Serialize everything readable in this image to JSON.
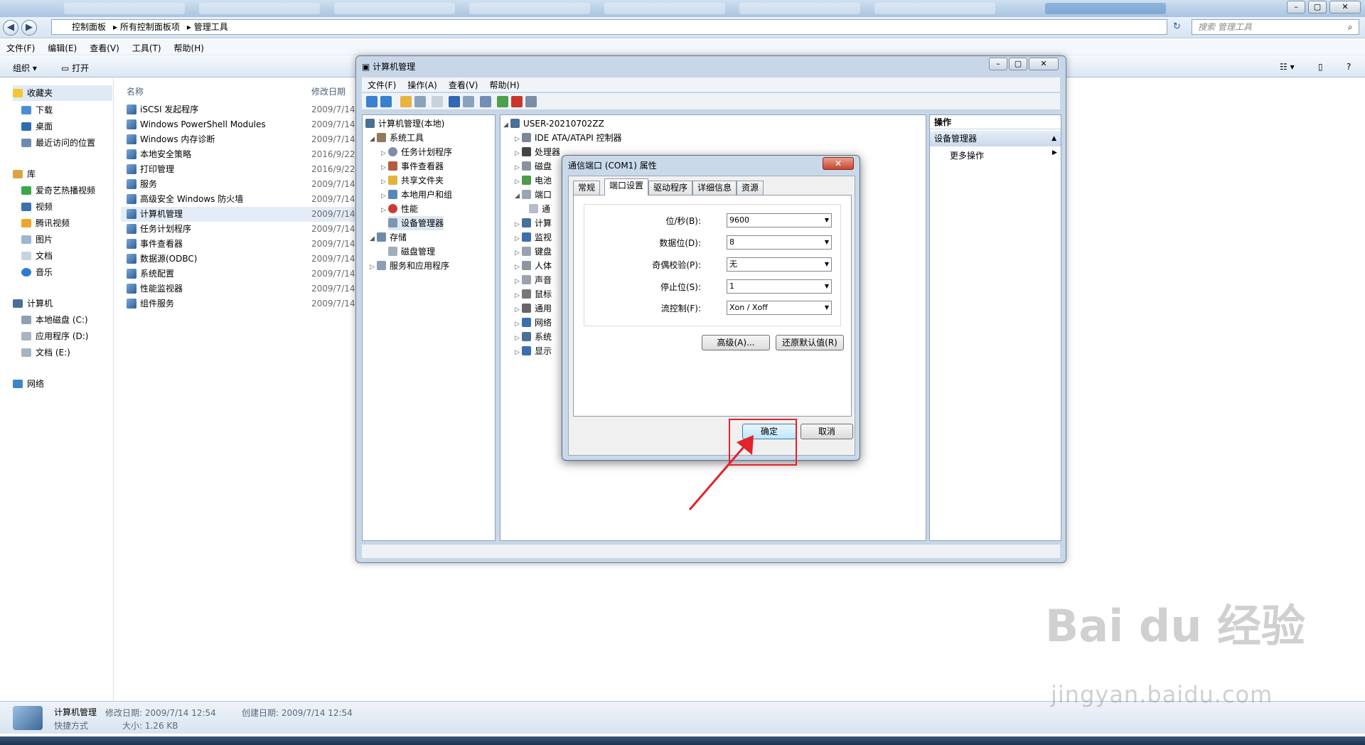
{
  "explorer": {
    "address": [
      "控制面板",
      "所有控制面板项",
      "管理工具"
    ],
    "search_placeholder": "搜索 管理工具",
    "menu": [
      "文件(F)",
      "编辑(E)",
      "查看(V)",
      "工具(T)",
      "帮助(H)"
    ],
    "toolbar": {
      "organize": "组织",
      "open": "打开"
    },
    "nav": {
      "favorites": "收藏夹",
      "fav_items": [
        "下载",
        "桌面",
        "最近访问的位置"
      ],
      "library": "库",
      "lib_items": [
        "爱奇艺热播视频",
        "视频",
        "腾讯视频",
        "图片",
        "文档",
        "音乐"
      ],
      "computer": "计算机",
      "drives": [
        "本地磁盘 (C:)",
        "应用程序 (D:)",
        "文档 (E:)"
      ],
      "network": "网络"
    },
    "columns": {
      "name": "名称",
      "date": "修改日期"
    },
    "files": [
      {
        "name": "iSCSI 发起程序",
        "date": "2009/7/14"
      },
      {
        "name": "Windows PowerShell Modules",
        "date": "2009/7/14"
      },
      {
        "name": "Windows 内存诊断",
        "date": "2009/7/14"
      },
      {
        "name": "本地安全策略",
        "date": "2016/9/22"
      },
      {
        "name": "打印管理",
        "date": "2016/9/22"
      },
      {
        "name": "服务",
        "date": "2009/7/14"
      },
      {
        "name": "高级安全 Windows 防火墙",
        "date": "2009/7/14"
      },
      {
        "name": "计算机管理",
        "date": "2009/7/14"
      },
      {
        "name": "任务计划程序",
        "date": "2009/7/14"
      },
      {
        "name": "事件查看器",
        "date": "2009/7/14"
      },
      {
        "name": "数据源(ODBC)",
        "date": "2009/7/14"
      },
      {
        "name": "系统配置",
        "date": "2009/7/14"
      },
      {
        "name": "性能监视器",
        "date": "2009/7/14"
      },
      {
        "name": "组件服务",
        "date": "2009/7/14"
      }
    ],
    "status": {
      "name": "计算机管理",
      "modified": "修改日期: 2009/7/14 12:54",
      "created": "创建日期: 2009/7/14 12:54",
      "type": "快捷方式",
      "size": "大小: 1.26 KB"
    }
  },
  "mmc": {
    "title": "计算机管理",
    "menu": [
      "文件(F)",
      "操作(A)",
      "查看(V)",
      "帮助(H)"
    ],
    "tree": [
      "计算机管理(本地)",
      "系统工具",
      "任务计划程序",
      "事件查看器",
      "共享文件夹",
      "本地用户和组",
      "性能",
      "设备管理器",
      "存储",
      "磁盘管理",
      "服务和应用程序"
    ],
    "devices": [
      "USER-20210702ZZ",
      "IDE ATA/ATAPI 控制器",
      "处理器",
      "磁盘",
      "电池",
      "端口",
      "通",
      "计算",
      "监视",
      "键盘",
      "人体",
      "声音",
      "鼠标",
      "通用",
      "网络",
      "系统",
      "显示"
    ],
    "actions": {
      "header": "操作",
      "selected": "设备管理器",
      "more": "更多操作"
    }
  },
  "dialog": {
    "title": "通信端口 (COM1) 属性",
    "tabs": [
      "常规",
      "端口设置",
      "驱动程序",
      "详细信息",
      "资源"
    ],
    "fields": [
      {
        "label": "位/秒(B):",
        "value": "9600"
      },
      {
        "label": "数据位(D):",
        "value": "8"
      },
      {
        "label": "奇偶校验(P):",
        "value": "无"
      },
      {
        "label": "停止位(S):",
        "value": "1"
      },
      {
        "label": "流控制(F):",
        "value": "Xon / Xoff"
      }
    ],
    "advanced": "高级(A)...",
    "restore": "还原默认值(R)",
    "ok": "确定",
    "cancel": "取消"
  },
  "watermark": {
    "brand": "Bai du 经验",
    "url": "jingyan.baidu.com"
  },
  "colors": {
    "highlight": "#e2232a",
    "accent": "#3c7fb1"
  }
}
